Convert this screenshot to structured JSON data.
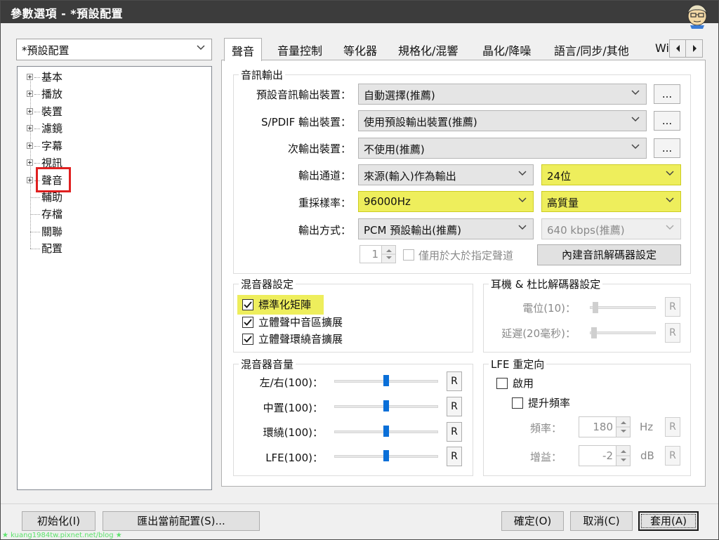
{
  "window": {
    "title": "參數選項 - *預設配置"
  },
  "profile_select": {
    "value": "*預設配置"
  },
  "tree": {
    "items": [
      {
        "label": "基本",
        "expandable": true
      },
      {
        "label": "播放",
        "expandable": true
      },
      {
        "label": "裝置",
        "expandable": true
      },
      {
        "label": "濾鏡",
        "expandable": true
      },
      {
        "label": "字幕",
        "expandable": true
      },
      {
        "label": "視訊",
        "expandable": true
      },
      {
        "label": "聲音",
        "expandable": true,
        "selected": true
      },
      {
        "label": "輔助",
        "expandable": false
      },
      {
        "label": "存檔",
        "expandable": false
      },
      {
        "label": "關聯",
        "expandable": false
      },
      {
        "label": "配置",
        "expandable": false
      }
    ],
    "highlight_color": "#e02020"
  },
  "tabs": [
    {
      "label": "聲音",
      "active": true
    },
    {
      "label": "音量控制"
    },
    {
      "label": "等化器"
    },
    {
      "label": "規格化/混響"
    },
    {
      "label": "晶化/降噪"
    },
    {
      "label": "語言/同步/其他"
    },
    {
      "label": "Wi"
    }
  ],
  "audio_output": {
    "title": "音訊輸出",
    "default_device": {
      "label": "預設音訊輸出裝置：",
      "value": "自動選擇(推薦)",
      "more": "..."
    },
    "spdif_device": {
      "label": "S/PDIF 輸出裝置：",
      "value": "使用預設輸出裝置(推薦)",
      "more": "..."
    },
    "secondary_device": {
      "label": "次輸出裝置：",
      "value": "不使用(推薦)",
      "more": "..."
    },
    "channels": {
      "label": "輸出通道：",
      "value": "來源(輸入)作為輸出",
      "bits": "24位"
    },
    "resample": {
      "label": "重採樣率：",
      "value": "96000Hz",
      "quality": "高質量"
    },
    "output_mode": {
      "label": "輸出方式：",
      "value": "PCM 預設輸出(推薦)",
      "bitrate": "640 kbps(推薦)"
    },
    "channel_count": "1",
    "only_if_more_label": "僅用於大於指定聲道",
    "decoder_settings_button": "內建音訊解碼器設定"
  },
  "mixer_settings": {
    "title": "混音器設定",
    "checkboxes": [
      {
        "label": "標準化矩陣",
        "checked": true,
        "highlighted": true
      },
      {
        "label": "立體聲中音區擴展",
        "checked": true
      },
      {
        "label": "立體聲環繞音擴展",
        "checked": true
      }
    ]
  },
  "headphone": {
    "title": "耳機 & 杜比解碼器設定",
    "level_label": "電位(10)：",
    "delay_label": "延遲(20毫秒)：",
    "reset": "R",
    "level_value": 0.05,
    "delay_value": 0.02
  },
  "mixer_volume": {
    "title": "混音器音量",
    "rows": [
      {
        "label": "左/右(100)：",
        "value": 0.5
      },
      {
        "label": "中置(100)：",
        "value": 0.5
      },
      {
        "label": "環繞(100)：",
        "value": 0.5
      },
      {
        "label": "LFE(100)：",
        "value": 0.5
      }
    ],
    "reset": "R"
  },
  "lfe": {
    "title": "LFE 重定向",
    "enable_label": "啟用",
    "boost_label": "提升頻率",
    "freq_label": "頻率：",
    "freq_value": "180",
    "freq_unit": "Hz",
    "gain_label": "增益：",
    "gain_value": "-2",
    "gain_unit": "dB",
    "reset": "R"
  },
  "footer": {
    "reset_button": "初始化(I)",
    "export_button": "匯出當前配置(S)...",
    "ok_button": "確定(O)",
    "cancel_button": "取消(C)",
    "apply_button": "套用(A)",
    "watermark": "★ kuang1984tw.pixnet.net/blog ★"
  },
  "colors": {
    "highlight": "#eeee5c",
    "accent": "#0a6fd8",
    "titlebar": "#3c3c3c"
  }
}
